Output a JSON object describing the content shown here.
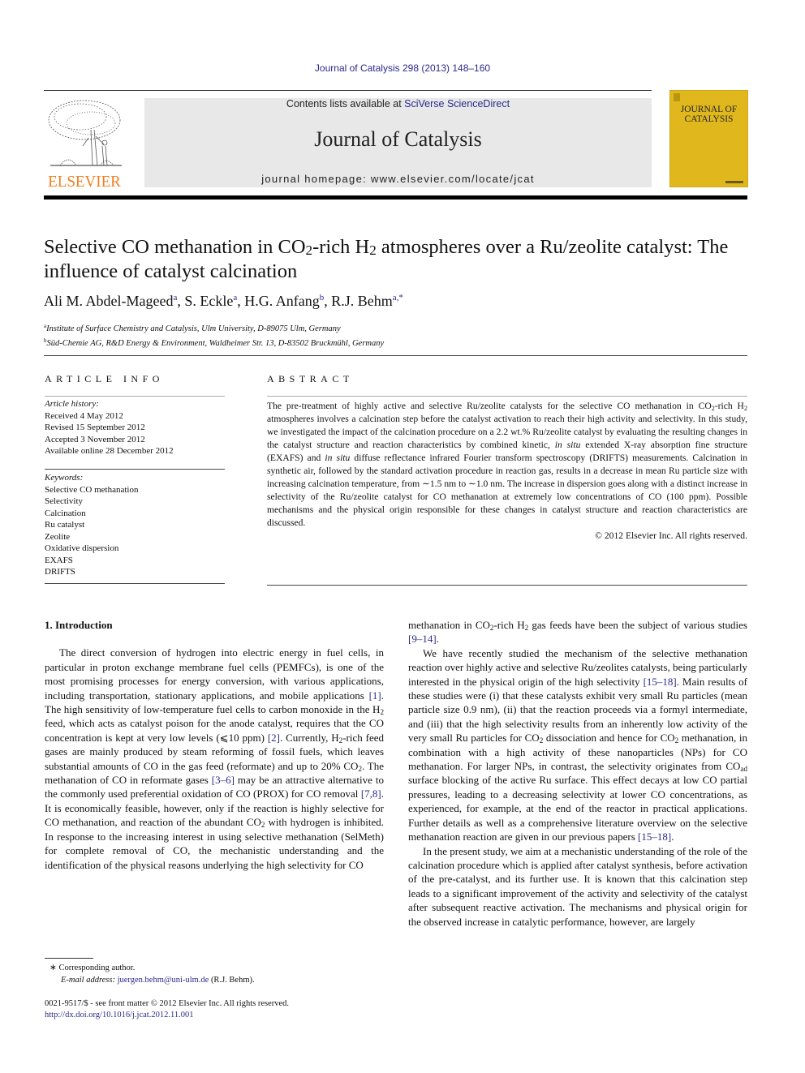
{
  "header": {
    "citation": "Journal of Catalysis 298 (2013) 148–160",
    "contents_prefix": "Contents lists available at ",
    "contents_link": "SciVerse ScienceDirect",
    "journal_title": "Journal of Catalysis",
    "homepage": "journal homepage: www.elsevier.com/locate/jcat",
    "publisher_logo_text": "ELSEVIER",
    "cover_title_line1": "JOURNAL OF",
    "cover_title_line2": "CATALYSIS",
    "colors": {
      "publisher_orange": "#f07f1f",
      "cover_yellow": "#e0b81e",
      "banner_gray": "#e8e8e8",
      "link_blue": "#2a2a8c"
    }
  },
  "article": {
    "title_part1": "Selective CO methanation in CO",
    "title_sub1": "2",
    "title_part2": "-rich H",
    "title_sub2": "2",
    "title_part3": " atmospheres over a Ru/zeolite catalyst: The influence of catalyst calcination",
    "authors": [
      {
        "name": "Ali M. Abdel-Mageed",
        "aff": "a"
      },
      {
        "name": "S. Eckle",
        "aff": "a"
      },
      {
        "name": "H.G. Anfang",
        "aff": "b"
      },
      {
        "name": "R.J. Behm",
        "aff": "a,*"
      }
    ],
    "affiliations": [
      {
        "key": "a",
        "text": "Institute of Surface Chemistry and Catalysis, Ulm University, D-89075 Ulm, Germany"
      },
      {
        "key": "b",
        "text": "Süd-Chemie AG, R&D Energy & Environment, Waldheimer Str. 13, D-83502 Bruckmühl, Germany"
      }
    ]
  },
  "article_info": {
    "heading": "ARTICLE INFO",
    "history_label": "Article history:",
    "history": [
      "Received 4 May 2012",
      "Revised 15 September 2012",
      "Accepted 3 November 2012",
      "Available online 28 December 2012"
    ],
    "keywords_label": "Keywords:",
    "keywords": [
      "Selective CO methanation",
      "Selectivity",
      "Calcination",
      "Ru catalyst",
      "Zeolite",
      "Oxidative dispersion",
      "EXAFS",
      "DRIFTS"
    ]
  },
  "abstract": {
    "heading": "ABSTRACT",
    "t1": "The pre-treatment of highly active and selective Ru/zeolite catalysts for the selective CO methanation in CO",
    "t2": "-rich H",
    "t3": " atmospheres involves a calcination step before the catalyst activation to reach their high activity and selectivity. In this study, we investigated the impact of the calcination procedure on a 2.2 wt.% Ru/zeolite catalyst by evaluating the resulting changes in the catalyst structure and reaction characteristics by combined kinetic, ",
    "i1": "in situ",
    "t4": " extended X-ray absorption fine structure (EXAFS) and ",
    "i2": "in situ",
    "t5": " diffuse reflectance infrared Fourier transform spectroscopy (DRIFTS) measurements. Calcination in synthetic air, followed by the standard activation procedure in reaction gas, results in a decrease in mean Ru particle size with increasing calcination temperature, from ∼1.5 nm to ∼1.0 nm. The increase in dispersion goes along with a distinct increase in selectivity of the Ru/zeolite catalyst for CO methanation at extremely low concentrations of CO (100 ppm). Possible mechanisms and the physical origin responsible for these changes in catalyst structure and reaction characteristics are discussed.",
    "sub": "2",
    "copyright": "© 2012 Elsevier Inc. All rights reserved."
  },
  "intro": {
    "heading": "1. Introduction",
    "p1": {
      "a": "The direct conversion of hydrogen into electric energy in fuel cells, in particular in proton exchange membrane fuel cells (PEMFCs), is one of the most promising processes for energy conversion, with various applications, including transportation, stationary applications, and mobile applications ",
      "r1": "[1]",
      "b": ". The high sensitivity of low-temperature fuel cells to carbon monoxide in the H",
      "c": " feed, which acts as catalyst poison for the anode catalyst, requires that the CO concentration is kept at very low levels (⩽10 ppm) ",
      "r2": "[2]",
      "d": ". Currently, H",
      "e": "-rich feed gases are mainly produced by steam reforming of fossil fuels, which leaves substantial amounts of CO in the gas feed (reformate) and up to 20% CO",
      "f": ". The methanation of CO in reformate gases ",
      "r3": "[3–6]",
      "g": " may be an attractive alternative to the commonly used preferential oxidation of CO (PROX) for CO removal ",
      "r4": "[7,8]",
      "h": ". It is economically feasible, however, only if the reaction is highly selective for CO methanation, and reaction of the abundant CO",
      "i": " with hydrogen is inhibited. In response to the increasing interest in using selective methanation (SelMeth) for complete removal of CO, the mechanistic understanding and the identification of the physical reasons underlying the high selectivity for CO methanation in CO",
      "j": "-rich H",
      "k": " gas feeds have been the subject of various studies ",
      "r5": "[9–14]",
      "l": "."
    },
    "p2": {
      "a": "We have recently studied the mechanism of the selective methanation reaction over highly active and selective Ru/zeolites catalysts, being particularly interested in the physical origin of the high selectivity ",
      "r1": "[15–18]",
      "b": ". Main results of these studies were (i) that these catalysts exhibit very small Ru particles (mean particle size 0.9 nm), (ii) that the reaction proceeds via a formyl intermediate, and (iii) that the high selectivity results from an inherently low activity of the very small Ru particles for CO",
      "c": " dissociation and hence for CO",
      "d": " methanation, in combination with a high activity of these nanoparticles (NPs) for CO methanation. For larger NPs, in contrast, the selectivity originates from CO",
      "ad": "ad",
      "e": " surface blocking of the active Ru surface. This effect decays at low CO partial pressures, leading to a decreasing selectivity at lower CO concentrations, as experienced, for example, at the end of the reactor in practical applications. Further details as well as a comprehensive literature overview on the selective methanation reaction are given in our previous papers ",
      "r2": "[15–18]",
      "f": "."
    },
    "p3": "In the present study, we aim at a mechanistic understanding of the role of the calcination procedure which is applied after catalyst synthesis, before activation of the pre-catalyst, and its further use. It is known that this calcination step leads to a significant improvement of the activity and selectivity of the catalyst after subsequent reactive activation. The mechanisms and physical origin for the observed increase in catalytic performance, however, are largely"
  },
  "footnotes": {
    "corresponding": "Corresponding author.",
    "email_label": "E-mail address:",
    "email": "juergen.behm@uni-ulm.de",
    "email_owner": " (R.J. Behm).",
    "issn": "0021-9517/$ - see front matter © 2012 Elsevier Inc. All rights reserved.",
    "doi": "http://dx.doi.org/10.1016/j.jcat.2012.11.001"
  }
}
